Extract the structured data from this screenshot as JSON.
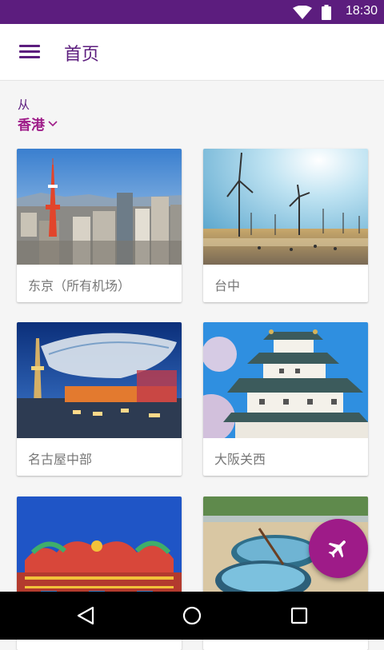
{
  "status_bar": {
    "time": "18:30"
  },
  "toolbar": {
    "title": "首页",
    "menu_icon": "hamburger-menu-icon"
  },
  "origin": {
    "label": "从",
    "value": "香港"
  },
  "destinations": [
    {
      "name": "东京（所有机场）",
      "image": "tokyo-skyline-photo"
    },
    {
      "name": "台中",
      "image": "wind-turbines-beach-photo"
    },
    {
      "name": "名古屋中部",
      "image": "nagoya-tower-photo"
    },
    {
      "name": "大阪关西",
      "image": "osaka-castle-photo"
    },
    {
      "name": "",
      "image": "temple-roof-dragons-photo"
    },
    {
      "name": "",
      "image": "basket-boats-beach-photo"
    }
  ],
  "fab": {
    "icon": "airplane-icon"
  },
  "colors": {
    "primary": "#5c1d7e",
    "accent": "#9e1b88"
  }
}
